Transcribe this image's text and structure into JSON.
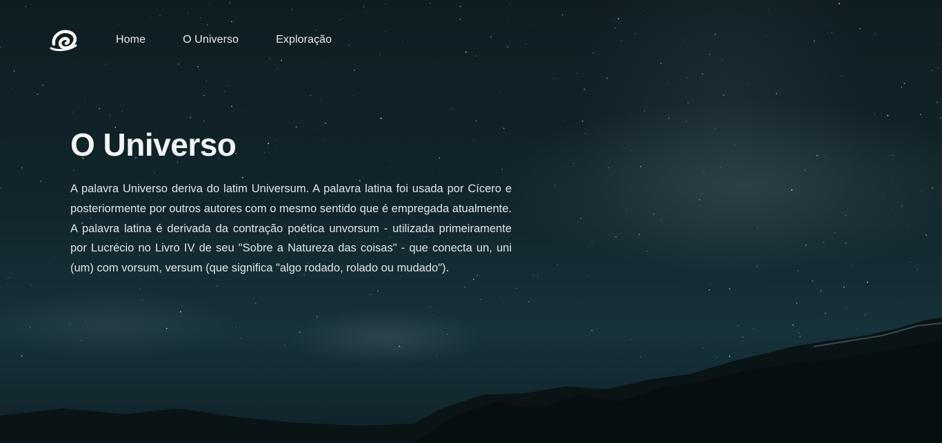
{
  "nav": {
    "logo_icon": "swirl-logo-icon",
    "items": [
      {
        "label": "Home"
      },
      {
        "label": "O Universo"
      },
      {
        "label": "Exploração"
      }
    ]
  },
  "hero": {
    "title": "O Universo",
    "text": "A palavra Universo deriva do latim Universum. A palavra latina foi usada por Cícero e posteriormente por outros autores com o mesmo sentido que é empregada atualmente. A palavra latina é derivada da contração poética unvorsum - utilizada primeiramente por Lucrécio no Livro IV de seu \"Sobre a Natureza das coisas\" - que conecta un, uni (um) com vorsum, versum (que significa \"algo rodado, rolado ou mudado\")."
  },
  "colors": {
    "background": "#0d1a1e",
    "text": "#e8ecef"
  }
}
